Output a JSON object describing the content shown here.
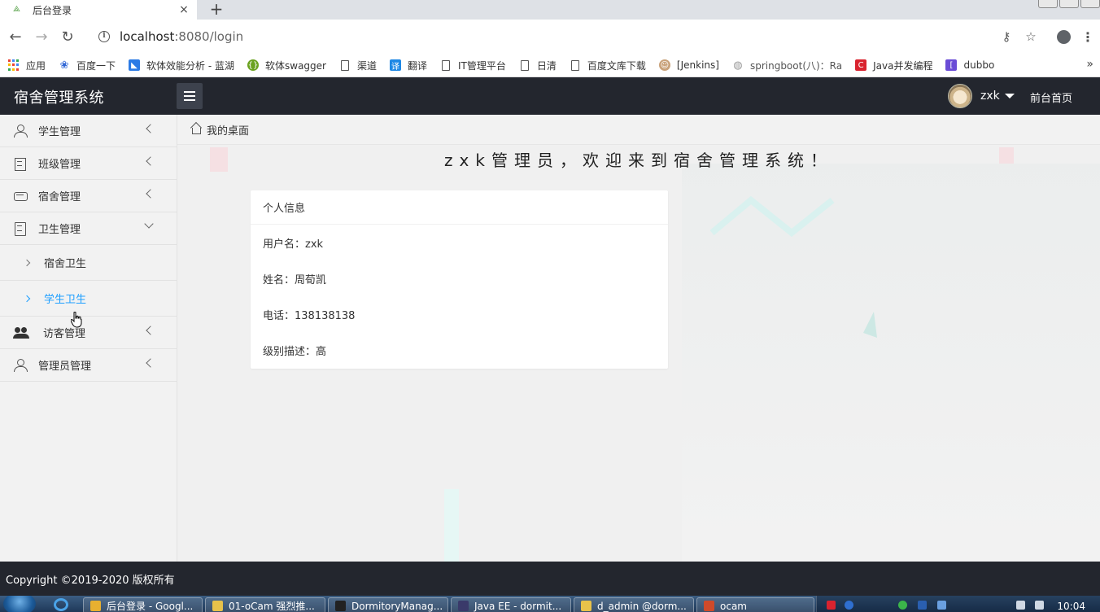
{
  "browser": {
    "tab_title": "后台登录",
    "tab_close": "×",
    "new_tab": "+",
    "url_host": "localhost",
    "url_path": ":8080/login",
    "bookmarks": [
      {
        "label": "应用",
        "icon": "apps-grid-icon"
      },
      {
        "label": "百度一下",
        "icon": "baidu-paw-icon",
        "color": "#2f66d5"
      },
      {
        "label": "软体效能分析 - 蓝湖",
        "icon": "lanhu-icon",
        "color": "#2c7be5"
      },
      {
        "label": "软体swagger",
        "icon": "swagger-icon",
        "color": "#6aa21f"
      },
      {
        "label": "渠道",
        "icon": "page-icon"
      },
      {
        "label": "翻译",
        "icon": "translate-icon",
        "color": "#1e88e5"
      },
      {
        "label": "IT管理平台",
        "icon": "page-icon"
      },
      {
        "label": "日清",
        "icon": "page-icon"
      },
      {
        "label": "百度文库下载",
        "icon": "page-icon"
      },
      {
        "label": "[Jenkins]",
        "icon": "jenkins-icon",
        "color": "#c9a27a"
      },
      {
        "label": "springboot(八)：Ra",
        "icon": "globe-icon",
        "color": "#999999"
      },
      {
        "label": "Java并发编程",
        "icon": "csdn-icon",
        "color": "#d9232f"
      },
      {
        "label": "dubbo",
        "icon": "dubbo-icon",
        "color": "#6a4cd6"
      }
    ],
    "more": "»"
  },
  "header": {
    "brand": "宿舍管理系统",
    "username": "zxk",
    "front_home": "前台首页"
  },
  "sidebar": {
    "items": [
      {
        "label": "学生管理",
        "icon": "user-icon",
        "expanded": false
      },
      {
        "label": "班级管理",
        "icon": "class-icon",
        "expanded": false
      },
      {
        "label": "宿舍管理",
        "icon": "dorm-icon",
        "expanded": false
      },
      {
        "label": "卫生管理",
        "icon": "hygiene-icon",
        "expanded": true,
        "children": [
          {
            "label": "宿舍卫生",
            "active": false
          },
          {
            "label": "学生卫生",
            "active": true
          }
        ]
      },
      {
        "label": "访客管理",
        "icon": "visitors-icon",
        "expanded": false
      },
      {
        "label": "管理员管理",
        "icon": "admin-icon",
        "expanded": false
      }
    ]
  },
  "main": {
    "breadcrumb": "我的桌面",
    "welcome": "zxk管理员，欢迎来到宿舍管理系统！",
    "card": {
      "title": "个人信息",
      "rows": [
        "用户名：zxk",
        "姓名：周荀凯",
        "电话：138138138",
        "级别描述：高"
      ]
    }
  },
  "footer": {
    "copyright": "Copyright ©2019-2020 版权所有"
  },
  "taskbar": {
    "buttons": [
      {
        "label": "后台登录 - Googl...",
        "icon": "chrome-icon",
        "color": "#e8b030"
      },
      {
        "label": "01-oCam 强烈推...",
        "icon": "folder-icon",
        "color": "#e8c24a"
      },
      {
        "label": "DormitoryManag...",
        "icon": "intellij-icon",
        "color": "#222222"
      },
      {
        "label": "Java EE - dormit...",
        "icon": "eclipse-icon",
        "color": "#3a3a6a"
      },
      {
        "label": "d_admin @dorm...",
        "icon": "navicat-icon",
        "color": "#e8c24a"
      },
      {
        "label": "ocam",
        "icon": "ocam-icon",
        "color": "#d04a2a"
      }
    ],
    "clock": "10:04"
  },
  "colors": {
    "header_bg": "#23262e",
    "active_link": "#1e9fff",
    "sidebar_bg": "#f2f2f2"
  }
}
